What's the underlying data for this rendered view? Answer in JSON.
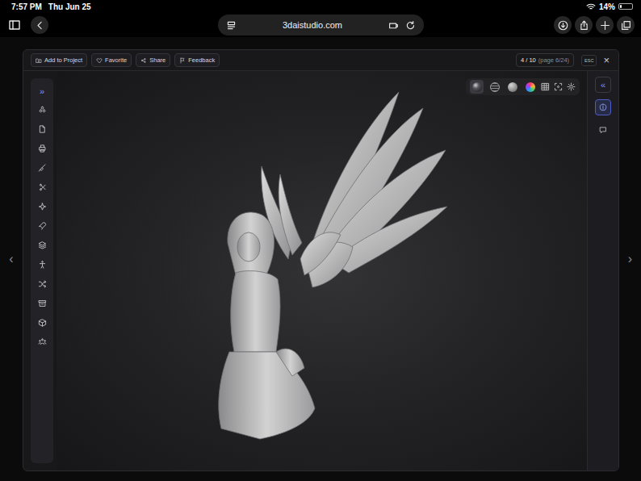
{
  "status_bar": {
    "time": "7:57 PM",
    "date": "Thu Jun 25",
    "battery": "14%",
    "battery_level": 0.14
  },
  "browser": {
    "url": "3daistudio.com"
  },
  "page_nav": {
    "previous": "‹",
    "next": "›"
  },
  "modal": {
    "actions": [
      "Add to Project",
      "Favorite",
      "Share",
      "Feedback"
    ],
    "counter": "4 / 10",
    "page": "(page 6/24)",
    "esc": "ESC",
    "close": "×"
  },
  "left_toolbar": {
    "expand": "»"
  },
  "render_modes": [
    {
      "kind": "matcap",
      "selected": true
    },
    {
      "kind": "wire",
      "selected": false
    },
    {
      "kind": "clay",
      "selected": false
    },
    {
      "kind": "color",
      "selected": false
    }
  ],
  "right_panel": {
    "collapse": "«",
    "tabs": [
      {
        "kind": "info",
        "selected": true
      },
      {
        "kind": "comments",
        "selected": false
      }
    ]
  }
}
